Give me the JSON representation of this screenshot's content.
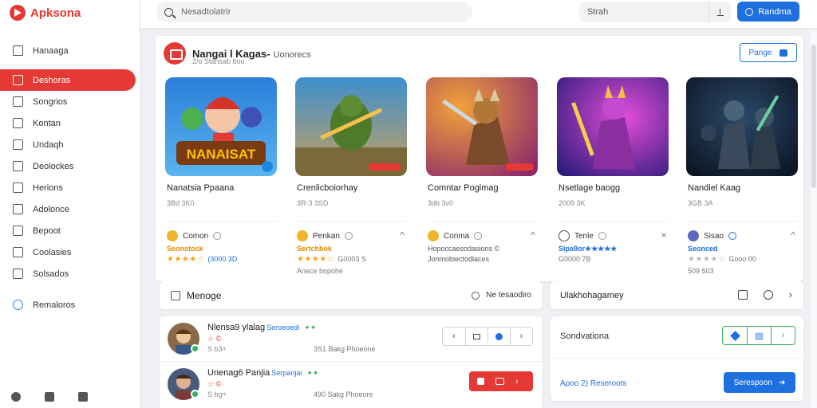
{
  "app": {
    "name": "Apksona"
  },
  "sidebar": {
    "items": [
      {
        "label": "Hanaaga",
        "icon": "home-icon"
      },
      {
        "label": "Deshoras",
        "icon": "grid-icon",
        "active": true
      },
      {
        "label": "Songrios",
        "icon": "music-icon"
      },
      {
        "label": "Kontan",
        "icon": "compass-icon"
      },
      {
        "label": "Undaqh",
        "icon": "update-icon"
      },
      {
        "label": "Deolockes",
        "icon": "lock-icon"
      },
      {
        "label": "Herions",
        "icon": "calendar-icon"
      },
      {
        "label": "Adolonce",
        "icon": "user-icon"
      },
      {
        "label": "Bepoot",
        "icon": "book-icon"
      },
      {
        "label": "Coolasies",
        "icon": "folder-icon"
      },
      {
        "label": "Solsados",
        "icon": "chart-icon"
      }
    ],
    "extra": {
      "label": "Remaloros",
      "icon": "history-icon"
    }
  },
  "topbar": {
    "search_placeholder": "Nesadtolatrir",
    "search2_placeholder": "Strah",
    "button_label": "Randma"
  },
  "section": {
    "title": "Nangai l Kagas-",
    "title_suffix": "Uonorecs",
    "subtitle": "2/o Stansab boo",
    "manage_label": "Pange"
  },
  "games": [
    {
      "thumb_text": "NANAISAT",
      "name": "Nanatsia Ppaana",
      "meta": "3Bd 3K0",
      "dev": "Comon",
      "sub": "Seonstock",
      "stars": "★★★★☆",
      "count": "(3000 3D",
      "extra": "",
      "action": ""
    },
    {
      "name": "Crenlicboiorhay",
      "meta": "3R-3 3SD",
      "dev": "Penkan",
      "sub": "Sertchbok",
      "stars": "★★★★☆",
      "count": "G0003 S",
      "extra": "Anece bopohe",
      "action": "^"
    },
    {
      "name": "Comntar Pogimag",
      "meta": "3db 3v0",
      "dev": "Conma",
      "sub": "Hopoccaesodasions ©",
      "stars": "",
      "count": "",
      "extra": "Jonmobiectodlaces",
      "action": "^"
    },
    {
      "name": "Nsetlage baogg",
      "meta": "2009 3K",
      "dev": "Tenle",
      "sub": "Sipa9or★★★★★",
      "stars": "",
      "count": "G0000 7B",
      "extra": "",
      "action": "×"
    },
    {
      "name": "Nandiel Kaag",
      "meta": "3GB 3A",
      "dev": "Sisao",
      "sub": "Seonced",
      "stars": "★★★★☆",
      "count": "Gooo 00",
      "extra": "509 503",
      "action": "^"
    }
  ],
  "lower_left": {
    "title": "Menoge",
    "right_label": "Ne tesaodiro"
  },
  "rows": [
    {
      "name": "Nlensa9 ylalag",
      "tag": "Seroeoedi",
      "tag2": "✦✦",
      "sub": "☆ ©",
      "meta": "S b3+",
      "mid": "3S1  Bakg  Phoeone"
    },
    {
      "name": "Unenag6 Panjia",
      "tag": "Serpanjai",
      "tag2": "✦✦",
      "sub": "☆ ©",
      "meta": "S bg+",
      "mid": "490  Sakg  Phoeore"
    }
  ],
  "right_panel": {
    "title": "Ulakhohagamey",
    "label": "Sondvationa",
    "link": "Apoo 2) Reseroots",
    "button_label": "Serespoon"
  },
  "colors": {
    "accent_red": "#e53935",
    "accent_blue": "#1e6fe0",
    "accent_green": "#35b35b"
  }
}
